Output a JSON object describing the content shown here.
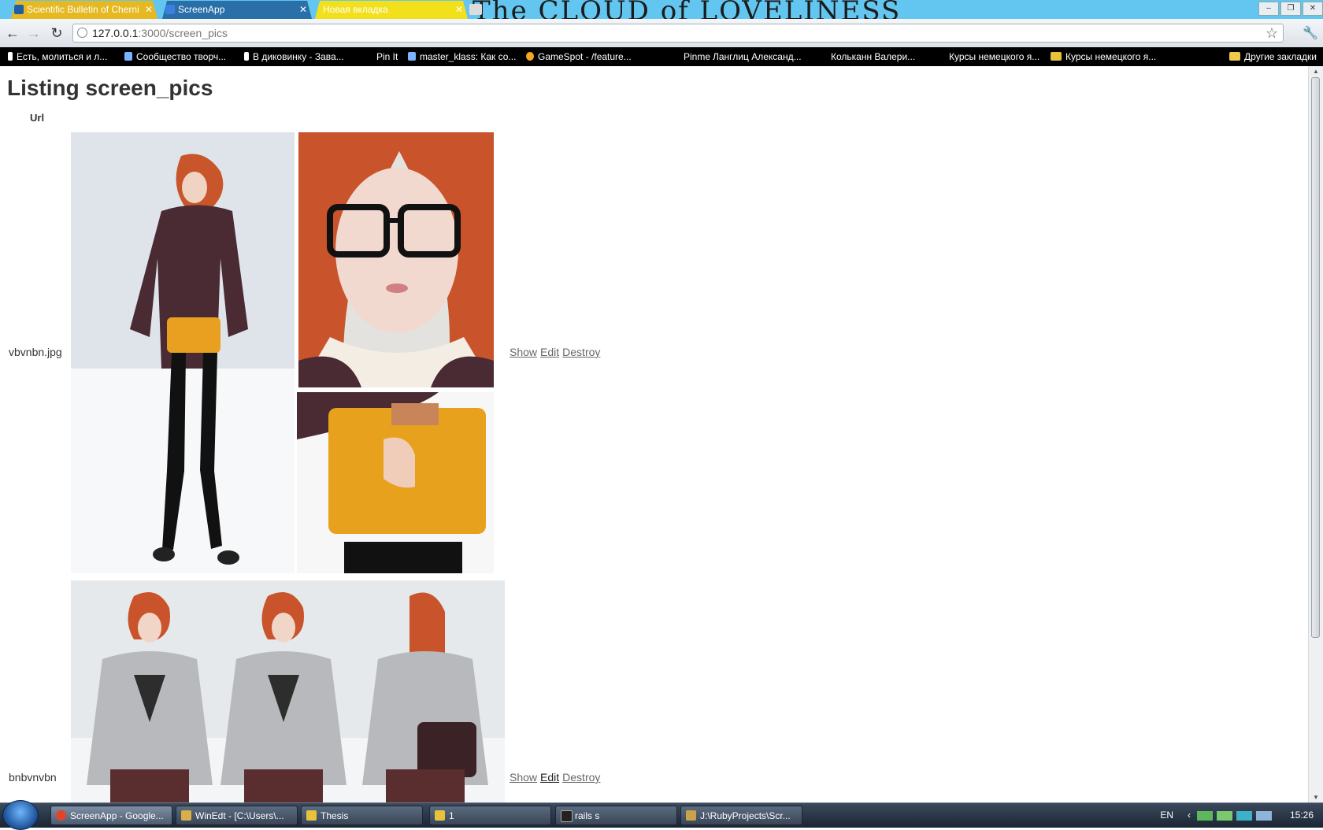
{
  "browser": {
    "tabs": [
      {
        "title": "Scientific Bulletin of Cherni",
        "close": "✕"
      },
      {
        "title": "ScreenApp",
        "close": "✕"
      },
      {
        "title": "Новая вкладка",
        "close": "✕"
      }
    ],
    "wallpaper_text": "The CLOUD of LOVELINESS",
    "window_controls": [
      "–",
      "❐",
      "✕"
    ],
    "address": {
      "host": "127.0.0.1",
      "path": ":3000/screen_pics"
    },
    "nav": {
      "back": "←",
      "forward": "→",
      "reload": "↻",
      "star": "☆",
      "wrench": "🔧"
    }
  },
  "bookmarks": {
    "items": [
      "Есть, молиться и л...",
      "Сообщество творч...",
      "В диковинку - Зава...",
      "Pin It",
      "master_klass: Как со...",
      "GameSpot - /feature...",
      "Pinme",
      "Ланглиц Александ...",
      "Кольканн Валери...",
      "Курсы немецкого я...",
      "Курсы немецкого я..."
    ],
    "other": "Другие закладки"
  },
  "page": {
    "title": "Listing screen_pics",
    "column_header": "Url",
    "rows": [
      {
        "url": "vbvnbn.jpg",
        "show": "Show",
        "edit": "Edit",
        "destroy": "Destroy"
      },
      {
        "url": "bnbvnvbn",
        "show": "Show",
        "edit": "Edit",
        "destroy": "Destroy"
      }
    ]
  },
  "taskbar": {
    "items": [
      "ScreenApp - Google...",
      "WinEdt - [C:\\Users\\...",
      "Thesis",
      "1",
      "rails  s",
      "J:\\RubyProjects\\Scr..."
    ],
    "tray": {
      "lang": "EN",
      "time": "15:26"
    }
  },
  "colors": {
    "titlebar": "#63c6f0",
    "bookmarks_bar": "#000000",
    "link": "#666666"
  }
}
